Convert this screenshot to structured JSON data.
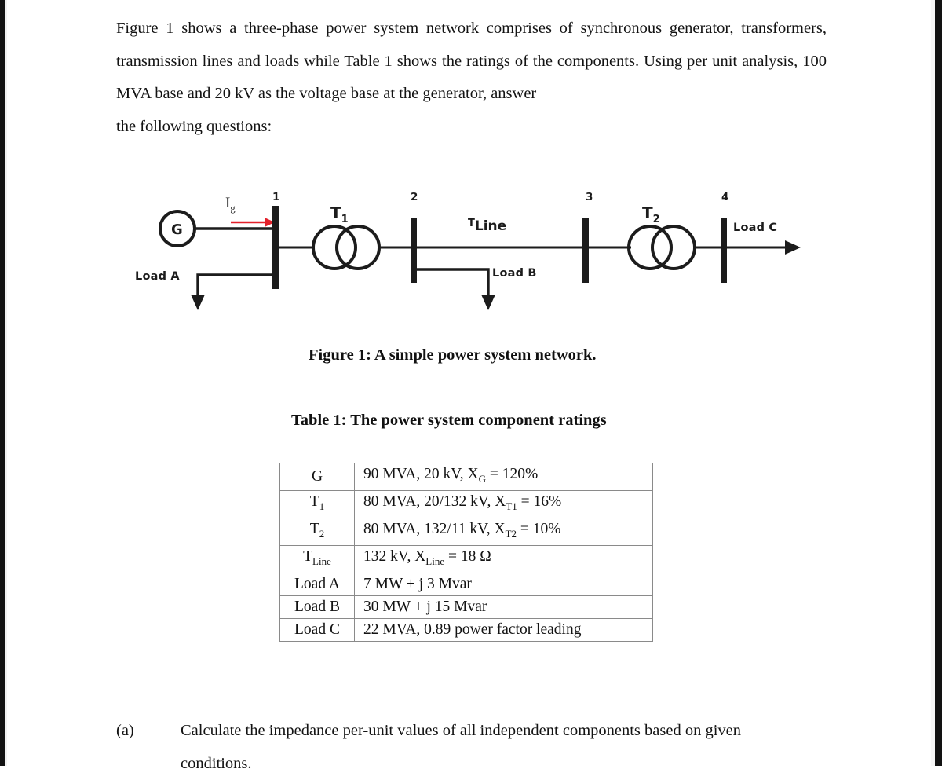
{
  "document": {
    "intro": {
      "line1": "Figure 1 shows a three-phase power system network comprises of synchronous generator,",
      "line2": "transformers, transmission lines and loads while Table 1 shows the ratings of the components.",
      "line3": "Using per unit analysis, 100 MVA base and 20 kV as the voltage base at the generator, answer",
      "line4": "the following questions:"
    },
    "figure": {
      "caption": "Figure 1: A simple power system network.",
      "generator_label": "G",
      "current_label": "I",
      "current_sub": "g",
      "bus_numbers": [
        "1",
        "2",
        "3",
        "4"
      ],
      "transformer1": "T",
      "transformer1_sub": "1",
      "transformer2": "T",
      "transformer2_sub": "2",
      "tline_sup": "T",
      "tline_label": "Line",
      "load_a": "Load A",
      "load_b": "Load B",
      "load_c": "Load C",
      "arrow_color": "#e3202a",
      "line_color": "#1c1c1c"
    },
    "table": {
      "caption": "Table 1: The power system component ratings",
      "rows": [
        {
          "component": "G",
          "component_sub": "",
          "spec_pre": "90 MVA, 20 kV, X",
          "spec_sub": "G",
          "spec_post": " = 120%"
        },
        {
          "component": "T",
          "component_sub": "1",
          "spec_pre": "80 MVA, 20/132 kV, X",
          "spec_sub": "T1",
          "spec_post": " = 16%"
        },
        {
          "component": "T",
          "component_sub": "2",
          "spec_pre": "80 MVA, 132/11 kV, X",
          "spec_sub": "T2",
          "spec_post": " = 10%"
        },
        {
          "component": "T",
          "component_sub": "Line",
          "spec_pre": "132 kV, X",
          "spec_sub": "Line",
          "spec_post": " = 18 Ω"
        },
        {
          "component": "Load A",
          "component_sub": "",
          "spec_pre": "7 MW + j 3 Mvar",
          "spec_sub": "",
          "spec_post": ""
        },
        {
          "component": "Load B",
          "component_sub": "",
          "spec_pre": "30 MW + j 15 Mvar",
          "spec_sub": "",
          "spec_post": ""
        },
        {
          "component": "Load C",
          "component_sub": "",
          "spec_pre": "22 MVA, 0.89 power factor leading",
          "spec_sub": "",
          "spec_post": ""
        }
      ]
    },
    "questions": [
      {
        "marker": "(a)",
        "line1": "Calculate the impedance per-unit values of all independent components based on given",
        "line2": "conditions."
      }
    ]
  }
}
